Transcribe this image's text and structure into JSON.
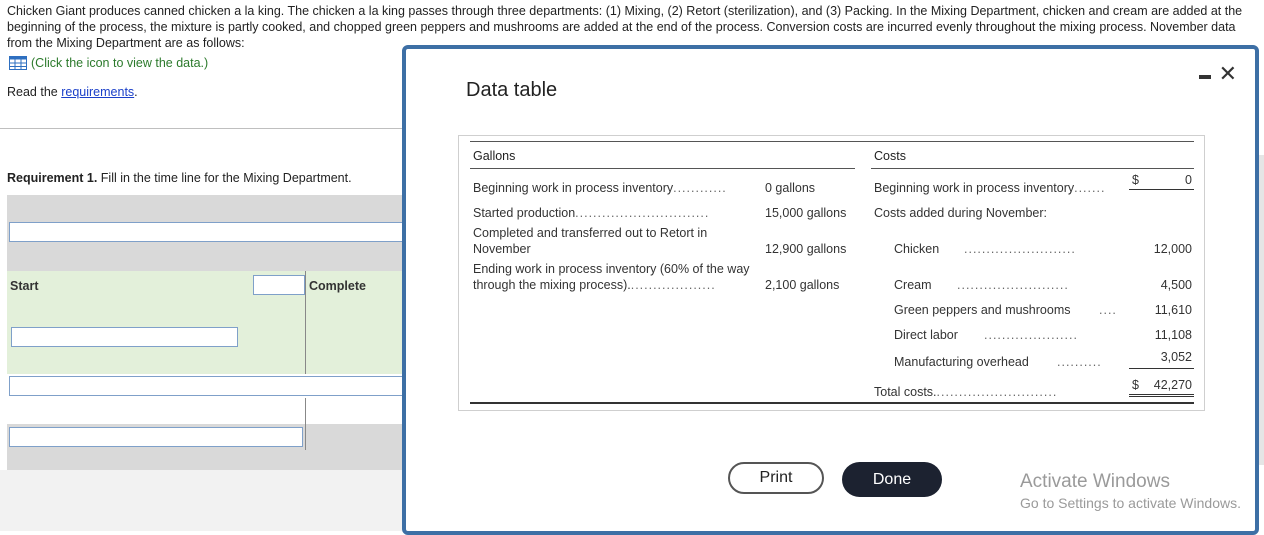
{
  "problem": {
    "text": "Chicken Giant produces canned chicken a la king. The chicken a la king passes through three departments: (1) Mixing, (2) Retort (sterilization), and (3) Packing. In the Mixing Department, chicken and cream are added at the beginning of the process, the mixture is partly cooked, and chopped green peppers and mushrooms are added at the end of the process. Conversion costs are incurred evenly throughout the mixing process. November data from the Mixing Department are as follows:",
    "click_text": "(Click the icon to view the data.)",
    "read_prefix": "Read the ",
    "requirements_link": "requirements",
    "read_suffix": "."
  },
  "requirement1": {
    "bold": "Requirement 1.",
    "text": " Fill in the time line for the Mixing Department."
  },
  "timeline": {
    "start_label": "Start",
    "complete_label": "Complete"
  },
  "modal": {
    "title": "Data table",
    "gallons_header": "Gallons",
    "costs_header": "Costs",
    "gallons_rows": [
      {
        "label": "Beginning work in process inventory",
        "dots": "............",
        "value": "0 gallons"
      },
      {
        "label": "Started production",
        "dots": "..............................",
        "value": "15,000 gallons"
      },
      {
        "label1": "Completed and transferred out to Retort in",
        "label2": "November",
        "value": "12,900 gallons"
      },
      {
        "label1": "Ending work in process inventory (60% of the way",
        "label2": "through the mixing process).",
        "dots": "...................",
        "value": "2,100 gallons"
      }
    ],
    "costs": {
      "beginning_label": "Beginning work in process inventory",
      "beginning_dots": ".......",
      "currency": "$",
      "beginning_value": "0",
      "added_label": "Costs added during November:",
      "items": [
        {
          "label": "Chicken",
          "dots": ".........................",
          "value": "12,000"
        },
        {
          "label": "Cream",
          "dots": ".........................",
          "value": "4,500"
        },
        {
          "label": "Green peppers and mushrooms",
          "dots": "....",
          "value": "11,610"
        },
        {
          "label": "Direct labor",
          "dots": ".....................",
          "value": "11,108"
        },
        {
          "label": "Manufacturing overhead",
          "dots": "..........",
          "value": "3,052"
        }
      ],
      "total_label": "Total costs.",
      "total_dots": "...........................",
      "total_currency": "$",
      "total_value": "42,270"
    },
    "print_label": "Print",
    "done_label": "Done"
  },
  "watermark": {
    "line1": "Activate Windows",
    "line2": "Go to Settings to activate Windows."
  },
  "colors": {
    "link": "#1a3fc9",
    "green_text": "#2c7a2c",
    "modal_border": "#3d6fa5",
    "done_bg": "#1c2230",
    "timeline_gray": "#d9d9d9",
    "timeline_green": "#e3f0da"
  }
}
